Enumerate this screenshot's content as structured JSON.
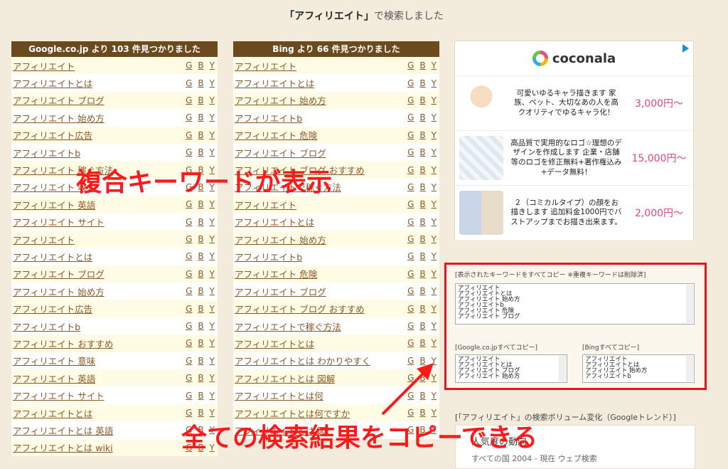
{
  "page_title": {
    "keyword": "「アフィリエイト」",
    "suffix": "で検索しました"
  },
  "google": {
    "header": "Google.co.jp より 103 件見つかりました",
    "items": [
      "アフィリエイト",
      "アフィリエイトとは",
      "アフィリエイト ブログ",
      "アフィリエイト 始め方",
      "アフィリエイト広告",
      "アフィリエイトb",
      "アフィリエイト 稼ぐ方法",
      "アフィリエイト 収入",
      "アフィリエイト 英語",
      "アフィリエイト サイト",
      "アフィリエイト",
      "アフィリエイトとは",
      "アフィリエイト ブログ",
      "アフィリエイト 始め方",
      "アフィリエイト広告",
      "アフィリエイトb",
      "アフィリエイト おすすめ",
      "アフィリエイト 意味",
      "アフィリエイト 英語",
      "アフィリエイト サイト",
      "アフィリエイトとは",
      "アフィリエイトとは 英語",
      "アフィリエイトとは wiki"
    ]
  },
  "bing": {
    "header": "Bing より 66 件見つかりました",
    "items": [
      "アフィリエイト",
      "アフィリエイトとは",
      "アフィリエイト 始め方",
      "アフィリエイトb",
      "アフィリエイト 危険",
      "アフィリエイト ブログ",
      "アフィリエイト ブログ おすすめ",
      "アフィリエイトで稼ぐ方法",
      "アフィリエイト",
      "アフィリエイトとは",
      "アフィリエイト 始め方",
      "アフィリエイトb",
      "アフィリエイト 危険",
      "アフィリエイト ブログ",
      "アフィリエイト ブログ おすすめ",
      "アフィリエイトで稼ぐ方法",
      "アフィリエイトとは",
      "アフィリエイトとは わかりやすく",
      "アフィリエイトとは 図解",
      "アフィリエイトとは何",
      "アフィリエイトとは何ですか",
      "アフィリエイトとは 図"
    ]
  },
  "engine_links": {
    "g": "G",
    "b": "B",
    "y": "Y"
  },
  "ad": {
    "brand": "coconala",
    "items": [
      {
        "desc": "可愛いゆるキャラ描きます 家族、ペット、大切なあの人を高クオリティでゆるキャラ化！",
        "price": "3,000円〜"
      },
      {
        "desc": "高品質で実用的なロゴ☆理想のデザインを作成します 企業・店舗等のロゴを修正無料+著作権込み+データ無料！",
        "price": "15,000円〜"
      },
      {
        "desc": "２（コミカルタイプ）の顔をお描きします 追加料金1000円でバストアップまでお描き出来ます。",
        "price": "2,000円〜"
      }
    ]
  },
  "copy_section": {
    "all_label": "[表示されたキーワードをすべてコピー ※重複キーワードは削除済]",
    "all_text": "アフィリエイト\nアフィリエイトとは\nアフィリエイト 始め方\nアフィリエイトb\nアフィリエイト 危険\nアフィリエイト ブログ",
    "google_label": "[Google.co.jpすべてコピー]",
    "google_text": "アフィリエイト\nアフィリエイトとは\nアフィリエイト ブログ\nアフィリエイト 始め方",
    "bing_label": "[Bingすべてコピー]",
    "bing_text": "アフィリエイト\nアフィリエイトとは\nアフィリエイト 始め方\nアフィリエイトb"
  },
  "trend": {
    "label": "[「アフィリエイト」の検索ボリューム変化（Googleトレンド）]",
    "title": "人気度の動向",
    "sub": "すべての国 2004 - 現在 ウェブ検索"
  },
  "annotations": {
    "compound": "複合キーワードが表示",
    "copy_all": "全ての検索結果をコピーできる"
  },
  "colors": {
    "header_bg": "#6b4a1e",
    "link": "#8a5a2a",
    "highlight_red": "#e8151b",
    "price_pink": "#e8467a"
  }
}
